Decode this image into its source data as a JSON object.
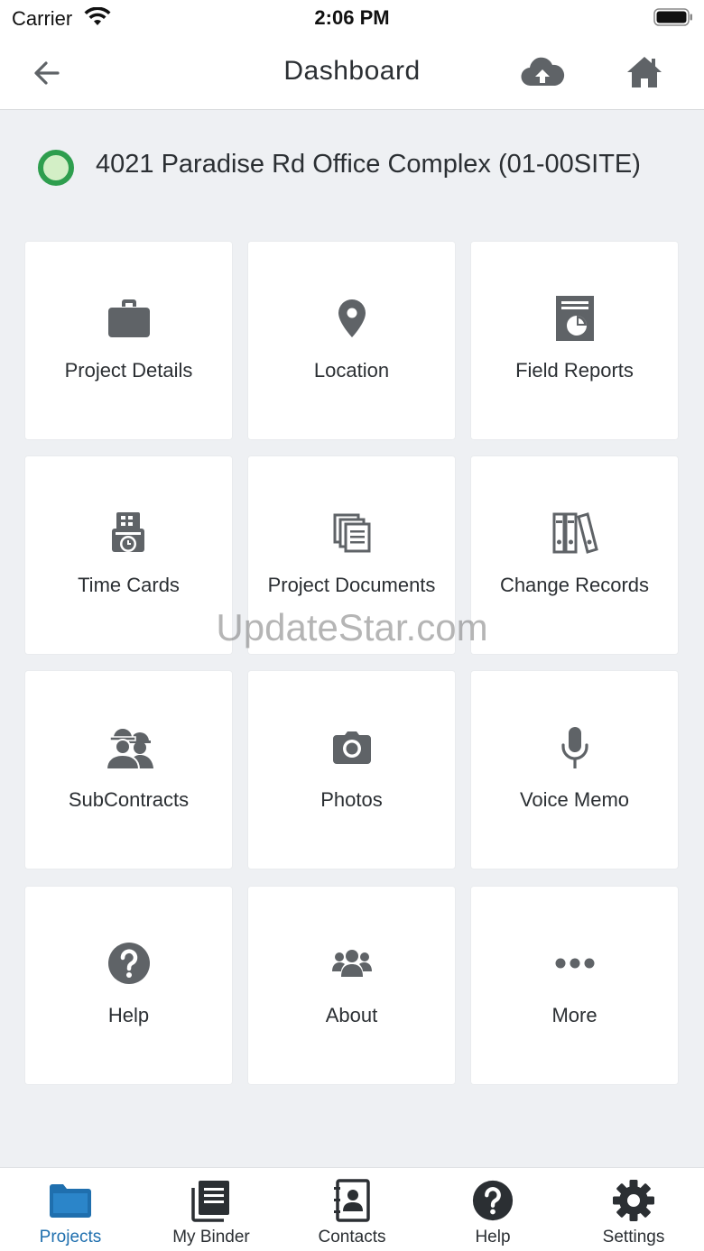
{
  "status_bar": {
    "carrier": "Carrier",
    "time": "2:06 PM"
  },
  "nav": {
    "title": "Dashboard",
    "back_icon": "arrow-left-icon",
    "cloud_icon": "cloud-upload-icon",
    "home_icon": "home-icon"
  },
  "project": {
    "name": "4021 Paradise Rd Office Complex  (01-00SITE)",
    "status_color": "#2e9e4e"
  },
  "tiles": [
    {
      "label": "Project Details",
      "icon": "briefcase-icon"
    },
    {
      "label": "Location",
      "icon": "map-pin-icon"
    },
    {
      "label": "Field Reports",
      "icon": "report-chart-icon"
    },
    {
      "label": "Time Cards",
      "icon": "time-card-icon"
    },
    {
      "label": "Project Documents",
      "icon": "documents-icon"
    },
    {
      "label": "Change Records",
      "icon": "binders-icon"
    },
    {
      "label": "SubContracts",
      "icon": "workers-icon"
    },
    {
      "label": "Photos",
      "icon": "camera-icon"
    },
    {
      "label": "Voice Memo",
      "icon": "microphone-icon"
    },
    {
      "label": "Help",
      "icon": "help-circle-icon"
    },
    {
      "label": "About",
      "icon": "people-icon"
    },
    {
      "label": "More",
      "icon": "ellipsis-icon"
    }
  ],
  "watermark": "UpdateStar.com",
  "tabs": [
    {
      "label": "Projects",
      "icon": "folder-icon",
      "active": true
    },
    {
      "label": "My Binder",
      "icon": "binder-icon",
      "active": false
    },
    {
      "label": "Contacts",
      "icon": "contacts-icon",
      "active": false
    },
    {
      "label": "Help",
      "icon": "help-icon",
      "active": false
    },
    {
      "label": "Settings",
      "icon": "gear-icon",
      "active": false
    }
  ],
  "colors": {
    "icon_gray": "#5f6367",
    "accent_blue": "#1f6fae",
    "background": "#eef0f3"
  }
}
